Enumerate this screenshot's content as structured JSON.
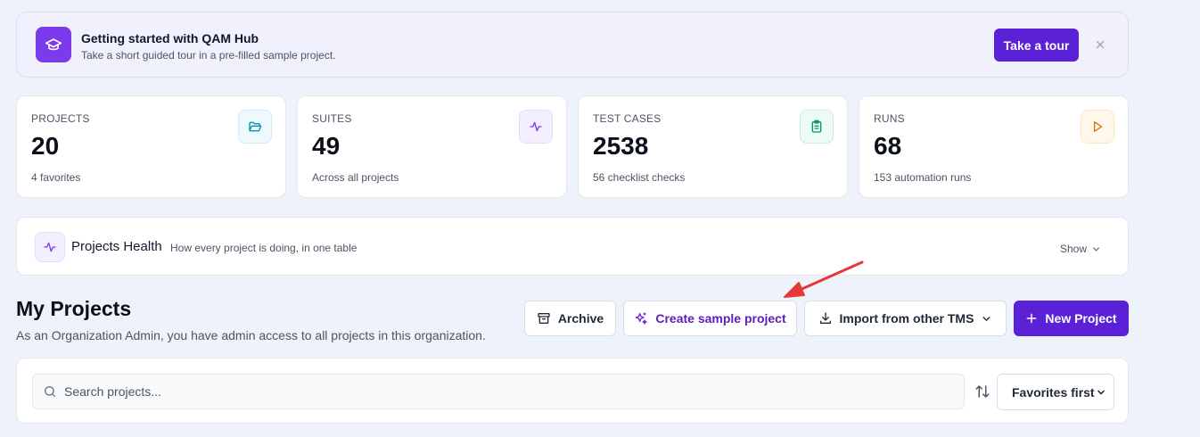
{
  "banner": {
    "title": "Getting started with QAM Hub",
    "subtitle": "Take a short guided tour in a pre-filled sample project.",
    "tour_label": "Take a tour",
    "icon": "graduation-cap-icon"
  },
  "stats": [
    {
      "label": "PROJECTS",
      "value": "20",
      "sub": "4 favorites",
      "icon": "folder-open-icon",
      "color": "#0891b2",
      "bg": "#eef9fd",
      "border": "#cdeef8"
    },
    {
      "label": "SUITES",
      "value": "49",
      "sub": "Across all projects",
      "icon": "activity-icon",
      "color": "#7c3aed",
      "bg": "#f3efff",
      "border": "#e4dcfb"
    },
    {
      "label": "TEST CASES",
      "value": "2538",
      "sub": "56 checklist checks",
      "icon": "clipboard-list-icon",
      "color": "#059669",
      "bg": "#ecfbf3",
      "border": "#c8f0db"
    },
    {
      "label": "RUNS",
      "value": "68",
      "sub": "153 automation runs",
      "icon": "play-icon",
      "color": "#d97706",
      "bg": "#fff8ea",
      "border": "#fbe8bf"
    }
  ],
  "health": {
    "title": "Projects Health",
    "subtitle": "How every project is doing, in one table",
    "show_label": "Show"
  },
  "projects": {
    "title": "My Projects",
    "subtitle": "As an Organization Admin, you have admin access to all projects in this organization.",
    "archive_label": "Archive",
    "sample_label": "Create sample project",
    "import_label": "Import from other TMS",
    "new_label": "New Project"
  },
  "search": {
    "placeholder": "Search projects...",
    "sort_value": "Favorites first"
  },
  "colors": {
    "accent": "#5b21d6",
    "annotation_arrow": "#e53935"
  }
}
